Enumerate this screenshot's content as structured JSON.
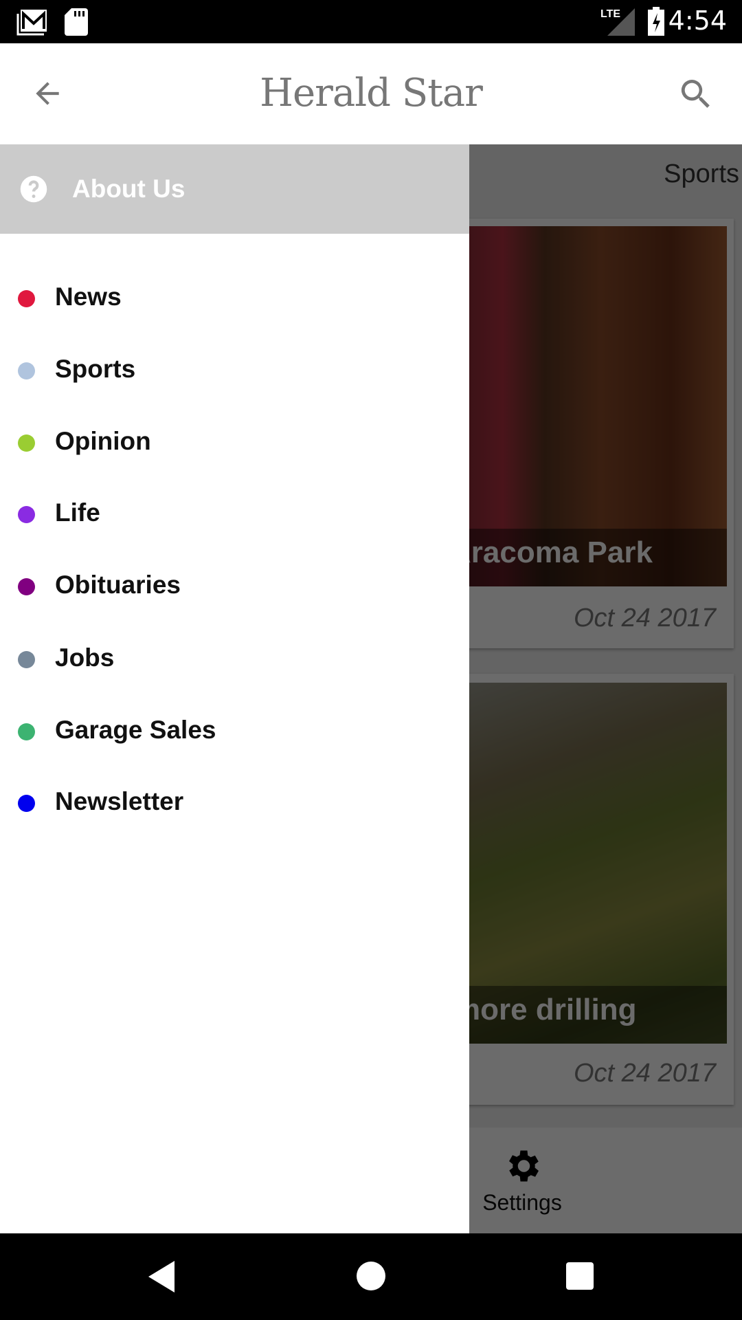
{
  "status_bar": {
    "time": "4:54",
    "network": "LTE",
    "icons": [
      "gmail-icon",
      "sd-card-icon",
      "signal-icon",
      "battery-charging-icon"
    ]
  },
  "app_bar": {
    "title": "Herald Star",
    "back_icon": "arrow-left-icon",
    "search_icon": "search-icon"
  },
  "background": {
    "tab": "Sports",
    "cards": [
      {
        "caption": "Aracoma Park",
        "date": "Oct 24 2017"
      },
      {
        "caption": "more drilling",
        "date": "Oct 24 2017"
      }
    ],
    "settings_label": "Settings"
  },
  "drawer": {
    "header": {
      "label": "About Us",
      "icon": "help-circle-icon"
    },
    "items": [
      {
        "label": "News",
        "color": "#e0183e"
      },
      {
        "label": "Sports",
        "color": "#b0c4de"
      },
      {
        "label": "Opinion",
        "color": "#9acd32"
      },
      {
        "label": "Life",
        "color": "#8a2be2"
      },
      {
        "label": "Obituaries",
        "color": "#800080"
      },
      {
        "label": "Jobs",
        "color": "#778899"
      },
      {
        "label": "Garage Sales",
        "color": "#3cb371"
      },
      {
        "label": "Newsletter",
        "color": "#0000ee"
      }
    ]
  }
}
